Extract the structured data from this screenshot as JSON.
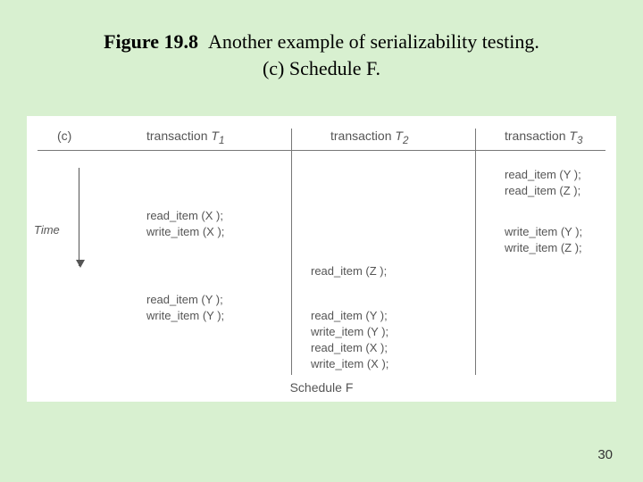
{
  "title": {
    "figure_label": "Figure 19.8",
    "figure_text": "Another example of serializability testing.",
    "subtitle": "(c) Schedule F."
  },
  "panel": {
    "label": "(c)",
    "headers": {
      "t1_prefix": "transaction ",
      "t1_name": "T",
      "t1_sub": "1",
      "t2_prefix": "transaction ",
      "t2_name": "T",
      "t2_sub": "2",
      "t3_prefix": "transaction ",
      "t3_name": "T",
      "t3_sub": "3"
    },
    "time_label": "Time",
    "caption": "Schedule F"
  },
  "ops": {
    "t3": {
      "r1": "read_item (Y );",
      "r2": "read_item (Z );",
      "r3": "write_item (Y );",
      "r4": "write_item (Z );"
    },
    "t1": {
      "r1": "read_item (X );",
      "r2": "write_item (X );",
      "r3": "read_item (Y );",
      "r4": "write_item (Y );"
    },
    "t2": {
      "r0": "read_item (Z );",
      "r1": "read_item (Y );",
      "r2": "write_item (Y );",
      "r3": "read_item (X );",
      "r4": "write_item (X );"
    }
  },
  "page_number": "30"
}
